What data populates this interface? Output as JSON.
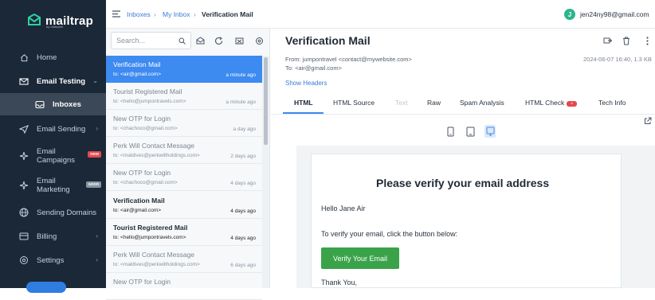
{
  "colors": {
    "sidebar_bg": "#1b2838",
    "accent": "#3d8af0",
    "primary_button": "#3aa34a",
    "badge_new": "#e5484d",
    "badge_soon": "#8895a3",
    "avatar_bg": "#2bb58d"
  },
  "brand": {
    "name": "mailtrap",
    "sub": "by railsware",
    "icon": "mailtrap-logo-icon"
  },
  "sidebar": {
    "items": [
      {
        "label": "Home",
        "icon": "home-icon"
      },
      {
        "label": "Email Testing",
        "icon": "email-testing-icon",
        "expanded": true
      },
      {
        "label": "Inboxes",
        "icon": "inbox-icon",
        "active": true
      },
      {
        "label": "Email Sending",
        "icon": "send-icon"
      },
      {
        "label": "Email Campaigns",
        "icon": "sparkle-icon",
        "badge": "new"
      },
      {
        "label": "Email Marketing",
        "icon": "sparkle-icon",
        "badge": "soon"
      },
      {
        "label": "Sending Domains",
        "icon": "globe-icon"
      },
      {
        "label": "Billing",
        "icon": "card-icon"
      },
      {
        "label": "Settings",
        "icon": "gear-icon"
      }
    ]
  },
  "breadcrumb": {
    "items": [
      "Inboxes",
      "My Inbox",
      "Verification Mail"
    ],
    "separator": "›"
  },
  "user": {
    "initial": "J",
    "email": "jen24ny98@gmail.com"
  },
  "search": {
    "placeholder": "Search..."
  },
  "messages": [
    {
      "subject": "Verification Mail",
      "to": "to: <air@gmail.com>",
      "time": "a minute ago",
      "selected": true
    },
    {
      "subject": "Tourist Registered Mail",
      "to": "to: <hello@jumpontravels.com>",
      "time": "a minute ago"
    },
    {
      "subject": "New OTP for Login",
      "to": "to: <chachoco@gmail.com>",
      "time": "a day ago"
    },
    {
      "subject": "Perk Will Contact Message",
      "to": "to: <maldives@perkwillholdings.com>",
      "time": "2 days ago"
    },
    {
      "subject": "New OTP for Login",
      "to": "to: <chachoco@gmail.com>",
      "time": "4 days ago"
    },
    {
      "subject": "Verification Mail",
      "to": "to: <air@gmail.com>",
      "time": "4 days ago",
      "unread": true
    },
    {
      "subject": "Tourist Registered Mail",
      "to": "to: <hello@jumpontravels.com>",
      "time": "4 days ago",
      "unread": true
    },
    {
      "subject": "Perk Will Contact Message",
      "to": "to: <maldives@perkwillholdings.com>",
      "time": "6 days ago"
    },
    {
      "subject": "New OTP for Login",
      "to": "",
      "time": ""
    }
  ],
  "message": {
    "title": "Verification Mail",
    "from": "From: jumpontravel <contact@mywebsite.com>",
    "to": "To:  <air@gmail.com>",
    "meta": "2024-06-07 16:40, 1.3 KB",
    "show_headers": "Show Headers",
    "tabs": [
      {
        "label": "HTML",
        "active": true
      },
      {
        "label": "HTML Source"
      },
      {
        "label": "Text",
        "disabled": true
      },
      {
        "label": "Raw"
      },
      {
        "label": "Spam Analysis"
      },
      {
        "label": "HTML Check",
        "badge": true
      },
      {
        "label": "Tech Info"
      }
    ],
    "devices": [
      "mobile-view-icon",
      "tablet-view-icon",
      "desktop-view-icon"
    ]
  },
  "email_body": {
    "heading": "Please verify your email address",
    "greeting": "Hello Jane Air",
    "instruction": "To verify your email, click the button below:",
    "button": "Verify Your Email",
    "closing": "Thank You,"
  }
}
